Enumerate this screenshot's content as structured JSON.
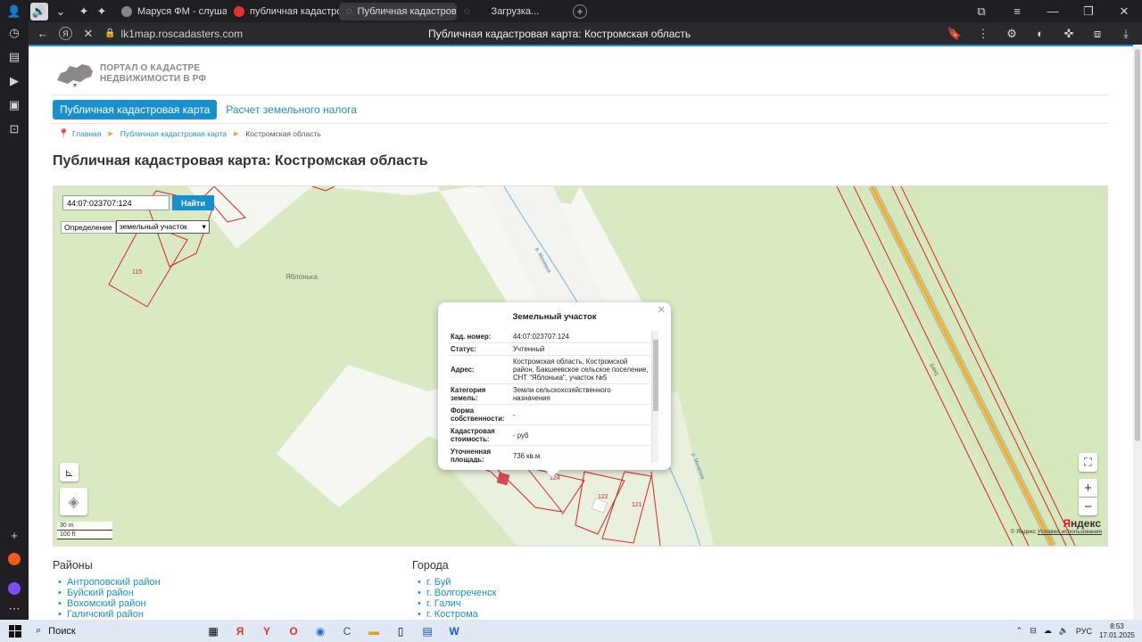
{
  "browser": {
    "tabs": [
      {
        "label": "Маруся ФМ - слуша",
        "color": "#6b6b70"
      },
      {
        "label": "публичная кадастровая к",
        "color": "#e3342f"
      },
      {
        "label": "Публичная кадастров",
        "color": "#4a4a4f",
        "active": true
      },
      {
        "label": "Загрузка...",
        "color": "#4a4a4f"
      }
    ],
    "url": "lk1map.roscadasters.com",
    "page_title": "Публичная кадастровая карта: Костромская область"
  },
  "site": {
    "logo_line1": "ПОРТАЛ О КАДАСТРЕ",
    "logo_line2": "НЕДВИЖИМОСТИ В РФ",
    "nav_active": "Публичная кадастровая карта",
    "nav_link": "Расчет земельного налога",
    "crumbs": [
      "Главная",
      "Публичная кадастровая карта",
      "Костромская область"
    ],
    "heading": "Публичная кадастровая карта: Костромская область"
  },
  "map": {
    "search_value": "44:07:023707:124",
    "search_button": "Найти",
    "definition_label": "Определение",
    "definition_value": "земельный участок",
    "place_label": "Яблонька",
    "river_label": "р. Мочехна",
    "road_label": "Б4Н1",
    "parcels": [
      "115",
      "124",
      "122",
      "121"
    ],
    "scale_m": "30 m",
    "scale_ft": "100 ft",
    "copyright": "© Яндекс",
    "terms": "Условия использования",
    "brand_first": "Я",
    "brand_rest": "ндекс"
  },
  "popup": {
    "title": "Земельный участок",
    "rows": [
      {
        "key": "Кад. номер:",
        "value": "44:07:023707:124"
      },
      {
        "key": "Статус:",
        "value": "Учтенный"
      },
      {
        "key": "Адрес:",
        "value": "Костромская область, Костромской район, Бакшеевское сельское поселение, СНТ \"Яблонька\", участок №5"
      },
      {
        "key": "Категория земель:",
        "value": "Земли сельскохозяйственного назначения"
      },
      {
        "key": "Форма собственности:",
        "value": "-"
      },
      {
        "key": "Кадастровая стоимость:",
        "value": "- руб"
      },
      {
        "key": "Уточненная площадь:",
        "value": "736 кв.м"
      }
    ]
  },
  "lists": {
    "districts_title": "Районы",
    "districts": [
      "Антроповский район",
      "Буйский район",
      "Вохомский район",
      "Галичский район"
    ],
    "cities_title": "Города",
    "cities": [
      "г. Буй",
      "г. Волгореченск",
      "г. Галич",
      "г. Кострома"
    ]
  },
  "taskbar": {
    "search": "Поиск",
    "lang": "РУС",
    "time": "8:53",
    "date": "17.01.2025"
  }
}
